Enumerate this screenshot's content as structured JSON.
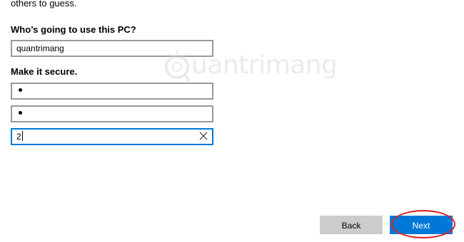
{
  "intro_text": "others to guess.",
  "user_section": {
    "label": "Who’s going to use this PC?",
    "username_value": "quantrimang"
  },
  "secure_section": {
    "label": "Make it secure.",
    "password_mask": "•",
    "confirm_mask": "•",
    "hint_value": "2"
  },
  "watermark": {
    "text": "uantrimang"
  },
  "buttons": {
    "back_label": "Back",
    "next_label": "Next"
  },
  "colors": {
    "accent": "#0078d7",
    "highlight_ring": "#e02020",
    "field_border": "#999999",
    "back_bg": "#cccccc"
  }
}
